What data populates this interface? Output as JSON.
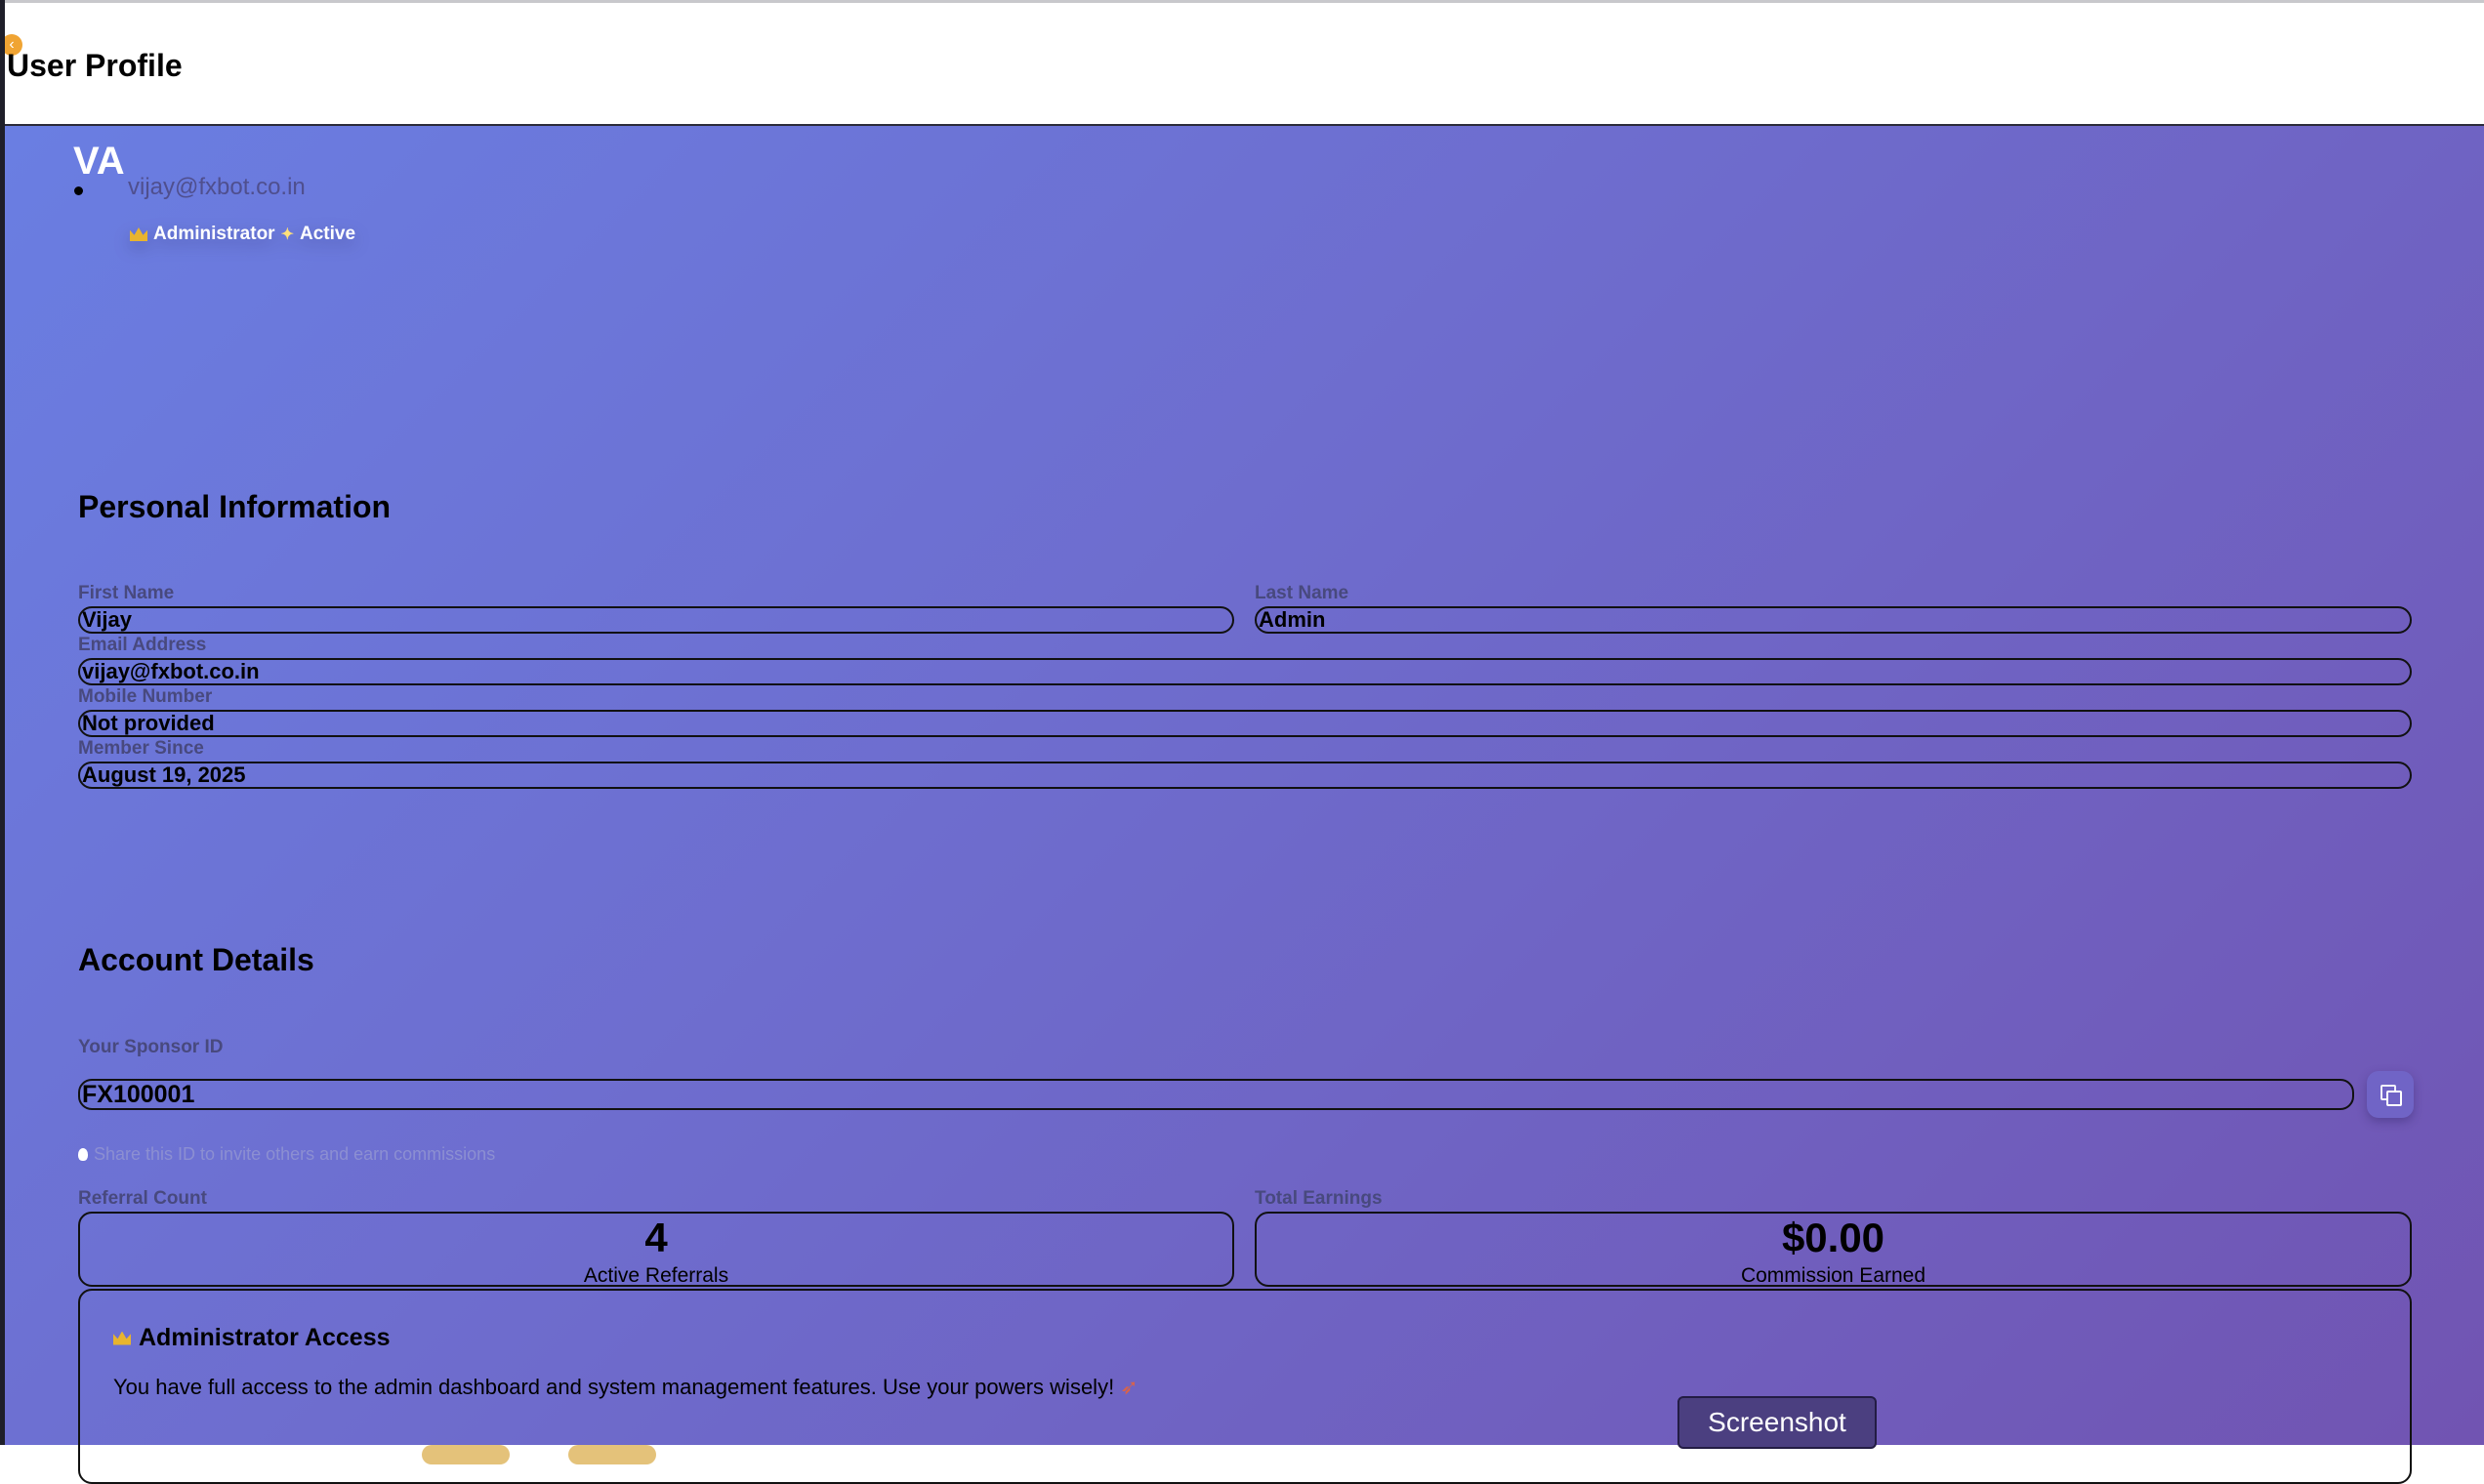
{
  "header": {
    "title": "User Profile",
    "collapse_icon": "‹"
  },
  "profile": {
    "initials": "VA",
    "email": "vijay@fxbot.co.in",
    "badges": {
      "role": "Administrator",
      "status": "Active"
    }
  },
  "personal_info": {
    "heading": "Personal Information",
    "first_name": {
      "label": "First Name",
      "value": "Vijay"
    },
    "last_name": {
      "label": "Last Name",
      "value": "Admin"
    },
    "email": {
      "label": "Email Address",
      "value": "vijay@fxbot.co.in"
    },
    "mobile": {
      "label": "Mobile Number",
      "value": "Not provided"
    },
    "member_since": {
      "label": "Member Since",
      "value": "August 19, 2025"
    }
  },
  "account": {
    "heading": "Account Details",
    "sponsor_label": "Your Sponsor ID",
    "sponsor_id": "FX100001",
    "hint": "Share this ID to invite others and earn commissions",
    "referral": {
      "label": "Referral Count",
      "value": "4",
      "caption": "Active Referrals"
    },
    "earnings": {
      "label": "Total Earnings",
      "value": "$0.00",
      "caption": "Commission Earned"
    }
  },
  "admin": {
    "title": "Administrator Access",
    "description": "You have full access to the admin dashboard and system management features. Use your powers wisely!"
  },
  "screenshot_button": "Screenshot",
  "icons": {
    "collapse": "chevron-left-icon",
    "crown": "crown-icon",
    "sparkle": "sparkle-icon",
    "copy": "copy-icon",
    "bulb": "lightbulb-icon",
    "rocket": "rocket-icon"
  },
  "colors": {
    "gradient_start": "#6a7ee2",
    "gradient_end": "#7154b2",
    "accent_orange": "#f0a433",
    "label_text": "#48497e"
  }
}
